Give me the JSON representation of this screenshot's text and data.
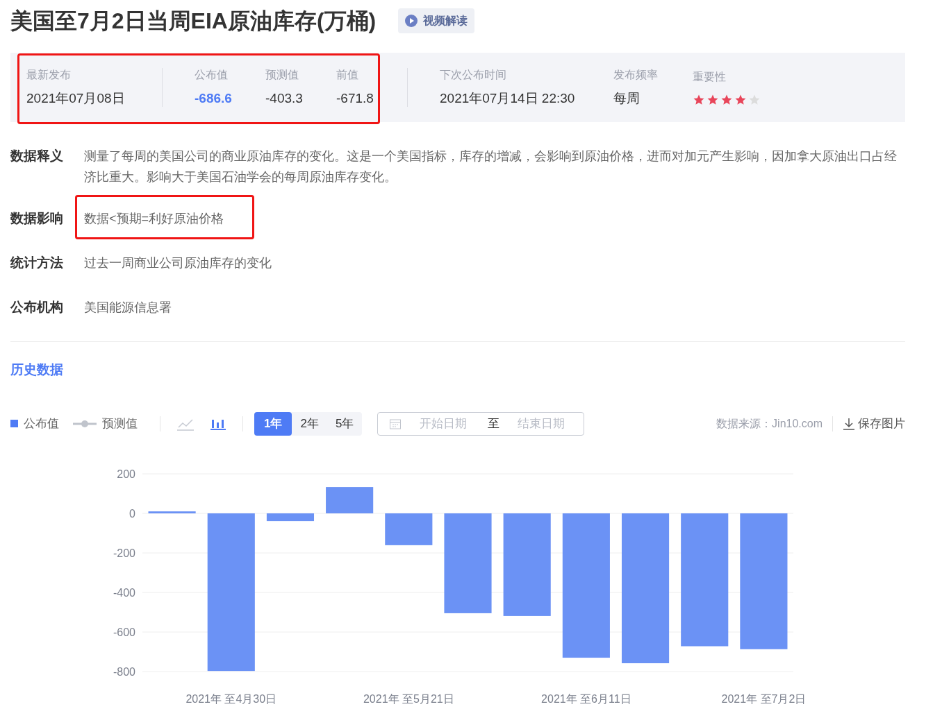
{
  "title": "美国至7月2日当周EIA原油库存(万桶)",
  "video_button": "视频解读",
  "summary": {
    "highlighted": true,
    "latest": {
      "label": "最新发布",
      "value": "2021年07月08日"
    },
    "figures": [
      {
        "label": "公布值",
        "value": "-686.6",
        "emphasis": true
      },
      {
        "label": "预测值",
        "value": "-403.3",
        "emphasis": false
      },
      {
        "label": "前值",
        "value": "-671.8",
        "emphasis": false
      }
    ],
    "next": {
      "label": "下次公布时间",
      "value": "2021年07月14日 22:30"
    },
    "frequency": {
      "label": "发布频率",
      "value": "每周"
    },
    "importance": {
      "label": "重要性",
      "stars": 4
    }
  },
  "details": [
    {
      "label": "数据释义",
      "text": "测量了每周的美国公司的商业原油库存的变化。这是一个美国指标，库存的增减，会影响到原油价格，进而对加元产生影响，因加拿大原油出口占经济比重大。影响大于美国石油学会的每周原油库存变化。",
      "highlighted": false
    },
    {
      "label": "数据影响",
      "text": "数据<预期=利好原油价格",
      "highlighted": true
    },
    {
      "label": "统计方法",
      "text": "过去一周商业公司原油库存的变化",
      "highlighted": false
    },
    {
      "label": "公布机构",
      "text": "美国能源信息署",
      "highlighted": false
    }
  ],
  "history": {
    "title": "历史数据",
    "legend": [
      {
        "label": "公布值",
        "kind": "square",
        "color": "#4e7bf5"
      },
      {
        "label": "预测值",
        "kind": "line",
        "color": "#c0c4cc"
      }
    ],
    "chart_types": [
      {
        "kind": "line",
        "selected": false
      },
      {
        "kind": "bar",
        "selected": true
      }
    ],
    "ranges": [
      {
        "label": "1年",
        "selected": true
      },
      {
        "label": "2年",
        "selected": false
      },
      {
        "label": "5年",
        "selected": false
      }
    ],
    "date_range": {
      "start_placeholder": "开始日期",
      "separator": "至",
      "end_placeholder": "结束日期"
    },
    "source": "数据来源：Jin10.com",
    "save_button": "保存图片",
    "chart_data": {
      "type": "bar",
      "categories": [
        null,
        "2021年 至4月30日",
        null,
        null,
        "2021年 至5月21日",
        null,
        null,
        "2021年 至6月11日",
        null,
        null,
        "2021年 至7月2日"
      ],
      "grid": true,
      "series": [
        {
          "color": "#6b92f5",
          "values": [
            10,
            -797,
            -39,
            133,
            -161,
            -505,
            -519,
            -730,
            -758,
            -672,
            -687
          ]
        }
      ],
      "ylim": [
        -800,
        200
      ],
      "yticks": [
        200,
        0,
        -200,
        -400,
        -600,
        -800
      ]
    }
  }
}
